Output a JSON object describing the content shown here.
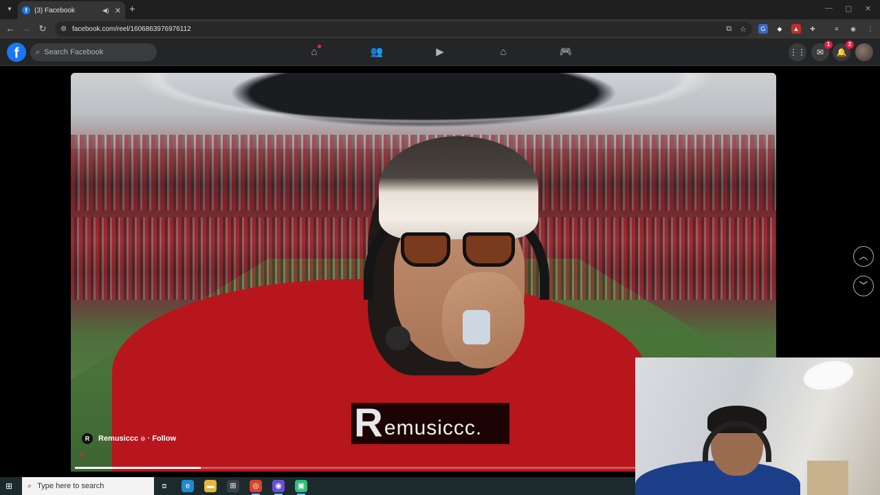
{
  "browser": {
    "tab_title": "(3) Facebook",
    "url": "facebook.com/reel/1606863976976112"
  },
  "facebook": {
    "search_placeholder": "Search Facebook",
    "messenger_badge": "1",
    "notifications_badge": "2"
  },
  "reel": {
    "author": "Remusiccc",
    "follow_label": "Follow",
    "separator": "·",
    "logo_letter": "R",
    "logo_text": "emusiccc.",
    "progress": 0.18
  },
  "taskbar": {
    "search_placeholder": "Type here to search"
  },
  "colors": {
    "fb_blue": "#1877f2",
    "badge_red": "#e41e3f",
    "sweater_red": "#b8161d"
  }
}
